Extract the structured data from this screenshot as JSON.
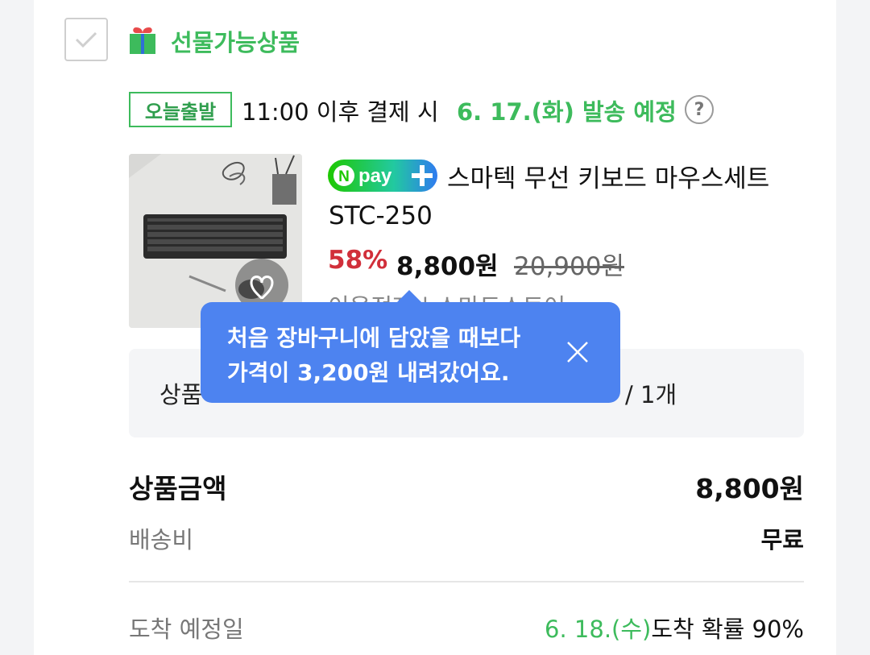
{
  "gift": {
    "label": "선물가능상품",
    "icon": "gift-box-icon"
  },
  "shipping": {
    "badge": "오늘출발",
    "text": "11:00 이후 결제 시",
    "date": "6. 17.(화) 발송 예정",
    "help": "?"
  },
  "product": {
    "npay_label": "pay",
    "title_line1": "스마텍 무선 키보드 마우스세트",
    "title_line2": "STC-250",
    "discount": "58%",
    "price": "8,800원",
    "original_price": "20,900원",
    "seller": "이음전자 | 스마트스토어"
  },
  "option": {
    "prefix": "상품",
    "quantity": "/ 1개"
  },
  "tooltip": {
    "line1": "처음 장바구니에 담았을 때보다",
    "line2": "가격이 3,200원 내려갔어요."
  },
  "summary": {
    "product_amount_label": "상품금액",
    "product_amount_value": "8,800원",
    "shipping_fee_label": "배송비",
    "shipping_fee_value": "무료",
    "arrival_label": "도착 예정일",
    "arrival_date": "6. 18.(수)",
    "arrival_prob": "도착 확률 90%"
  },
  "colors": {
    "green": "#3dbb5c",
    "red": "#d12f3a",
    "blue": "#4d83f0"
  }
}
